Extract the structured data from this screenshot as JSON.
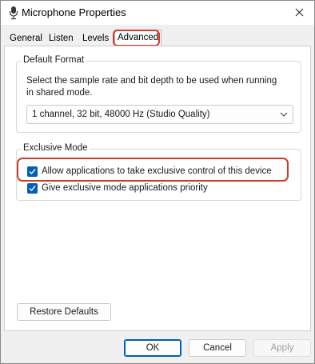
{
  "window": {
    "title": "Microphone Properties",
    "icon": "microphone-icon"
  },
  "tabs": [
    {
      "label": "General"
    },
    {
      "label": "Listen"
    },
    {
      "label": "Levels"
    },
    {
      "label": "Advanced",
      "active": true
    }
  ],
  "default_format": {
    "group_title": "Default Format",
    "description_line1": "Select the sample rate and bit depth to be used when running",
    "description_line2": "in shared mode.",
    "selected_format": "1 channel, 32 bit, 48000 Hz (Studio Quality)"
  },
  "exclusive_mode": {
    "group_title": "Exclusive Mode",
    "allow_exclusive_label": "Allow applications to take exclusive control of this device",
    "allow_exclusive_checked": true,
    "priority_label": "Give exclusive mode applications priority",
    "priority_checked": true
  },
  "buttons": {
    "restore_defaults": "Restore Defaults",
    "ok": "OK",
    "cancel": "Cancel",
    "apply": "Apply"
  },
  "colors": {
    "accent": "#005fb8",
    "highlight": "#d03b2b"
  }
}
